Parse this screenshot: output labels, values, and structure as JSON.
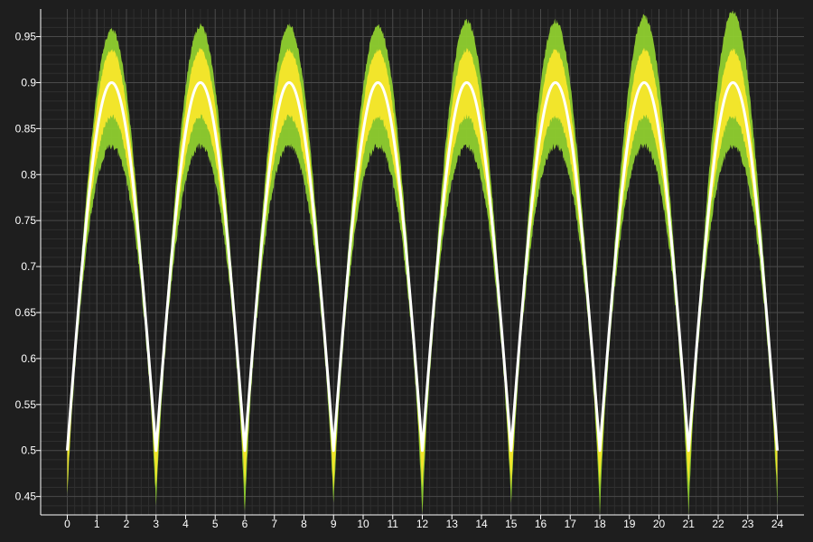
{
  "chart_data": {
    "type": "area",
    "title": "",
    "xlabel": "",
    "ylabel": "",
    "xlim": [
      -0.9,
      24.9
    ],
    "ylim": [
      0.43,
      0.98
    ],
    "x_ticks": [
      0,
      1,
      2,
      3,
      4,
      5,
      6,
      7,
      8,
      9,
      10,
      11,
      12,
      13,
      14,
      15,
      16,
      17,
      18,
      19,
      20,
      21,
      22,
      23,
      24
    ],
    "y_ticks": [
      0.45,
      0.5,
      0.55,
      0.6,
      0.65,
      0.7,
      0.75,
      0.8,
      0.85,
      0.9,
      0.95
    ],
    "x_tick_labels": [
      "0",
      "1",
      "2",
      "3",
      "4",
      "5",
      "6",
      "7",
      "8",
      "9",
      "10",
      "11",
      "12",
      "13",
      "14",
      "15",
      "16",
      "17",
      "18",
      "19",
      "20",
      "21",
      "22",
      "23",
      "24"
    ],
    "y_tick_labels": [
      "0.45",
      "0.5",
      "0.55",
      "0.6",
      "0.65",
      "0.7",
      "0.75",
      "0.8",
      "0.85",
      "0.9",
      "0.95"
    ],
    "grid": true,
    "minor_grid": true,
    "period": 3,
    "series": [
      {
        "role": "mean",
        "color": "#ffffff",
        "points": [
          [
            0,
            0.5
          ],
          [
            0.75,
            0.8
          ],
          [
            1.5,
            0.9
          ],
          [
            2.25,
            0.8
          ],
          [
            3,
            0.5
          ],
          [
            3.75,
            0.8
          ],
          [
            4.5,
            0.9
          ],
          [
            5.25,
            0.8
          ],
          [
            6,
            0.5
          ],
          [
            6.75,
            0.8
          ],
          [
            7.5,
            0.9
          ],
          [
            8.25,
            0.8
          ],
          [
            9,
            0.5
          ],
          [
            9.75,
            0.8
          ],
          [
            10.5,
            0.9
          ],
          [
            11.25,
            0.8
          ],
          [
            12,
            0.5
          ],
          [
            12.75,
            0.8
          ],
          [
            13.5,
            0.9
          ],
          [
            14.25,
            0.8
          ],
          [
            15,
            0.5
          ],
          [
            15.75,
            0.8
          ],
          [
            16.5,
            0.9
          ],
          [
            17.25,
            0.8
          ],
          [
            18,
            0.5
          ],
          [
            18.75,
            0.8
          ],
          [
            19.5,
            0.9
          ],
          [
            20.25,
            0.8
          ],
          [
            21,
            0.5
          ],
          [
            21.75,
            0.8
          ],
          [
            22.5,
            0.9
          ],
          [
            23.25,
            0.8
          ],
          [
            24,
            0.5
          ]
        ]
      },
      {
        "role": "band-outer",
        "color": "#8fcf2f",
        "upper_peak_values": [
          0.95,
          0.955,
          0.955,
          0.955,
          0.96,
          0.96,
          0.965,
          0.97
        ],
        "lower_peak_value": 0.84,
        "trough_min_values": [
          0.46,
          0.45,
          0.44,
          0.45,
          0.44,
          0.45,
          0.44,
          0.44,
          0.45
        ]
      },
      {
        "role": "band-inner",
        "color": "#f2e52b",
        "upper_peak_value": 0.93,
        "lower_peak_value": 0.87
      }
    ]
  },
  "colors": {
    "background": "#1e1e1e",
    "grid_major": "#4a4a4a",
    "grid_minor": "#2f2f2f",
    "axis": "#ffffff",
    "text": "#ffffff"
  }
}
